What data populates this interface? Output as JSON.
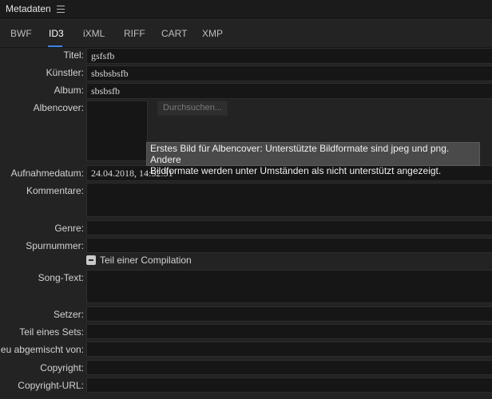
{
  "panel": {
    "title": "Metadaten",
    "menu_icon": "hamburger-menu-icon"
  },
  "tabs": [
    {
      "label": "BWF",
      "active": false
    },
    {
      "label": "ID3",
      "active": true
    },
    {
      "label": "iXML",
      "active": false
    },
    {
      "label": "RIFF",
      "active": false
    },
    {
      "label": "CART",
      "active": false
    },
    {
      "label": "XMP",
      "active": false
    }
  ],
  "fields": {
    "title": {
      "label": "Titel:",
      "value": "gsfsfb"
    },
    "artist": {
      "label": "Künstler:",
      "value": "sbsbsbsfb"
    },
    "album": {
      "label": "Album:",
      "value": "sbsbsfb"
    },
    "album_cover": {
      "label": "Albencover:",
      "browse_label": "Durchsuchen..."
    },
    "recording_date": {
      "label": "Aufnahmedatum:",
      "value": "24.04.2018, 14:52:31"
    },
    "comments": {
      "label": "Kommentare:",
      "value": ""
    },
    "genre": {
      "label": "Genre:",
      "value": ""
    },
    "track_number": {
      "label": "Spurnummer:",
      "value": ""
    },
    "compilation": {
      "label": "Teil einer Compilation",
      "checked": "mixed"
    },
    "lyrics": {
      "label": "Song-Text:",
      "value": ""
    },
    "composer": {
      "label": "Setzer:",
      "value": ""
    },
    "part_of_set": {
      "label": "Teil eines Sets:",
      "value": ""
    },
    "remixed_by": {
      "label": "Neu abgemischt von:",
      "value": ""
    },
    "copyright": {
      "label": "Copyright:",
      "value": ""
    },
    "copyright_url": {
      "label": "Copyright-URL:",
      "value": ""
    }
  },
  "tooltip": {
    "line1": "Erstes Bild für Albencover: Unterstützte Bildformate sind jpeg und png. Andere",
    "line2": "Bildformate werden unter Umständen als nicht unterstützt angezeigt."
  },
  "colors": {
    "accent": "#3e85e6",
    "background": "#232323",
    "field_background": "#161616"
  }
}
